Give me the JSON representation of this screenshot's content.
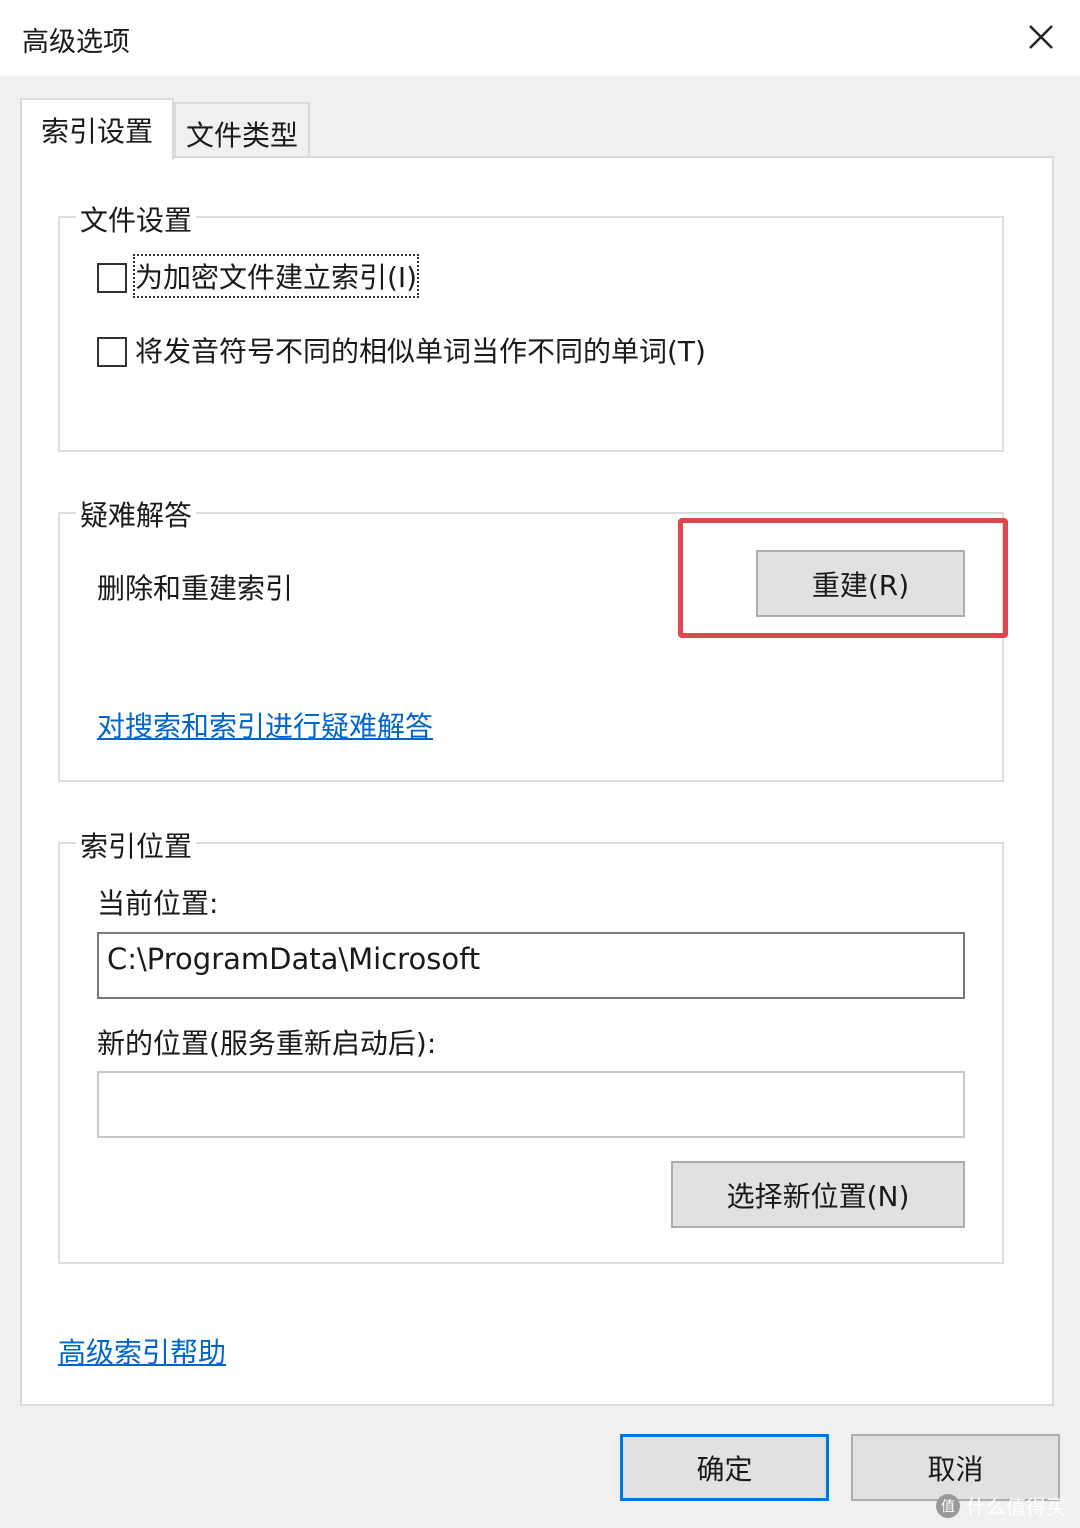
{
  "window": {
    "title": "高级选项"
  },
  "tabs": [
    {
      "label": "索引设置",
      "active": true
    },
    {
      "label": "文件类型",
      "active": false
    }
  ],
  "file_settings": {
    "legend": "文件设置",
    "options": [
      {
        "label": "为加密文件建立索引(I)",
        "checked": false
      },
      {
        "label": "将发音符号不同的相似单词当作不同的单词(T)",
        "checked": false
      }
    ]
  },
  "troubleshoot": {
    "legend": "疑难解答",
    "rebuild_description": "删除和重建索引",
    "rebuild_button": "重建(R)",
    "link": "对搜索和索引进行疑难解答"
  },
  "index_location": {
    "legend": "索引位置",
    "current_label": "当前位置:",
    "current_value": "C:\\ProgramData\\Microsoft",
    "new_label": "新的位置(服务重新启动后):",
    "new_value": "",
    "select_button": "选择新位置(N)"
  },
  "help_link": "高级索引帮助",
  "footer": {
    "ok": "确定",
    "cancel": "取消"
  },
  "watermark": "什么值得买",
  "colors": {
    "highlight": "#e0464e",
    "link": "#0066cc",
    "default_button_border": "#0078d7"
  }
}
